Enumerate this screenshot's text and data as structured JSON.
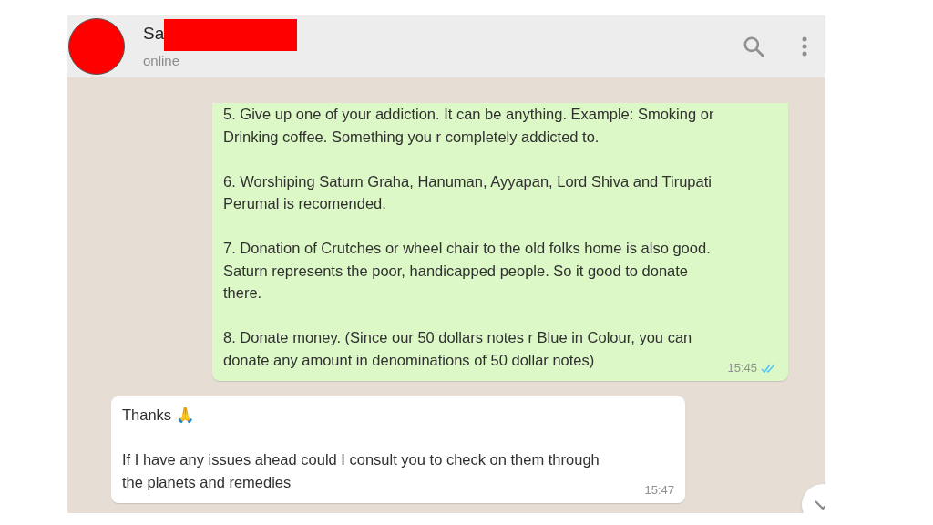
{
  "header": {
    "name": "Sa",
    "status": "online",
    "name_redacted": true
  },
  "messages": [
    {
      "outgoing": true,
      "paragraphs": [
        [
          "5. Give up one of your addiction. It can be anything. Example: Smoking or",
          "Drinking coffee. Something you r completely addicted to."
        ],
        [
          "6. Worshiping Saturn Graha, Hanuman, Ayyapan, Lord Shiva and Tirupati",
          "Perumal is recomended."
        ],
        [
          "7. Donation of Crutches or wheel chair to the old folks home is also good.",
          "Saturn represents the poor, handicapped people. So it good to donate",
          "there."
        ],
        [
          "8. Donate money. (Since our 50 dollars notes r Blue in Colour, you can",
          "donate any amount in denominations of 50 dollar notes)"
        ]
      ],
      "time": "15:45",
      "read": true
    },
    {
      "outgoing": false,
      "paragraphs": [
        [
          "Thanks 🙏"
        ],
        [
          "If I have any issues ahead could I consult you to check on them through",
          "the planets and remedies"
        ]
      ],
      "time": "15:47"
    }
  ]
}
